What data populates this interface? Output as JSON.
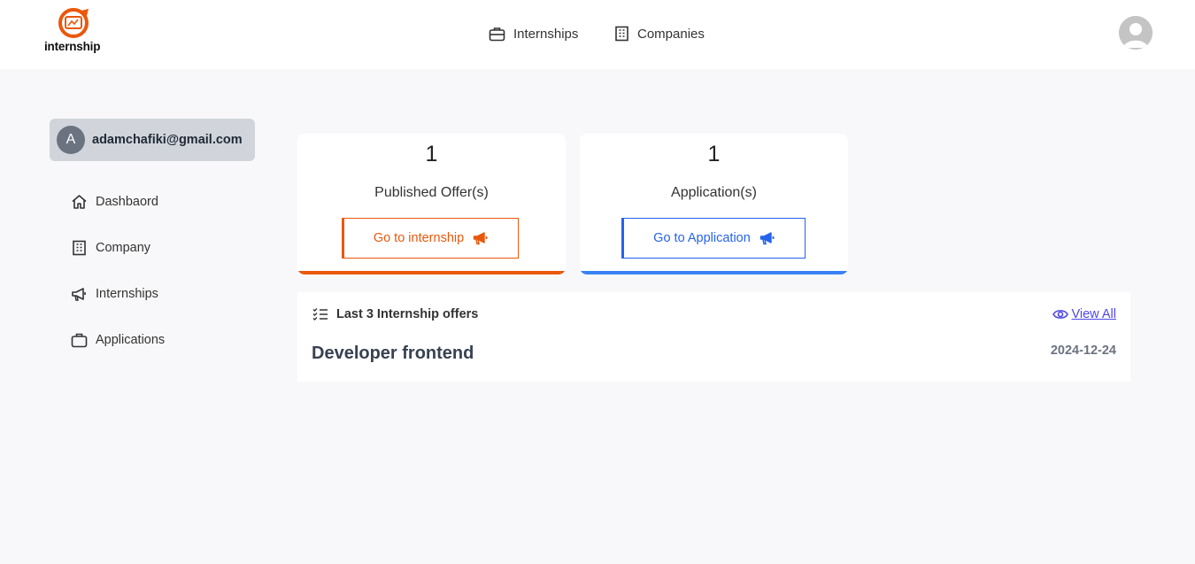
{
  "brand": {
    "name": "internship",
    "accent": "#ea580c"
  },
  "topnav": [
    {
      "label": "Internships",
      "icon": "briefcase-icon"
    },
    {
      "label": "Companies",
      "icon": "building-icon"
    }
  ],
  "user": {
    "initial": "A",
    "email": "adamchafiki@gmail.com"
  },
  "sidebar": {
    "items": [
      {
        "label": "Dashbaord",
        "icon": "home-icon"
      },
      {
        "label": "Company",
        "icon": "building-icon"
      },
      {
        "label": "Internships",
        "icon": "megaphone-icon"
      },
      {
        "label": "Applications",
        "icon": "briefcase-icon"
      }
    ]
  },
  "stats": {
    "offers": {
      "count": "1",
      "label": "Published Offer(s)",
      "button": "Go to internship",
      "color": "#ea580c"
    },
    "applications": {
      "count": "1",
      "label": "Application(s)",
      "button": "Go to Application",
      "color": "#3b82f6"
    }
  },
  "offers": {
    "heading": "Last 3 Internship offers",
    "view_all": "View All",
    "items": [
      {
        "title": "Developer frontend",
        "date": "2024-12-24"
      }
    ]
  }
}
